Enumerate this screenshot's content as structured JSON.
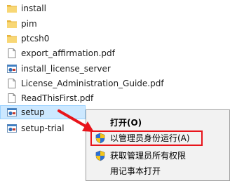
{
  "files": [
    {
      "name": "install",
      "icon": "folder-icon"
    },
    {
      "name": "pim",
      "icon": "folder-icon"
    },
    {
      "name": "ptcsh0",
      "icon": "folder-icon"
    },
    {
      "name": "export_affirmation.pdf",
      "icon": "document-icon"
    },
    {
      "name": "install_license_server",
      "icon": "application-icon"
    },
    {
      "name": "License_Administration_Guide.pdf",
      "icon": "document-icon"
    },
    {
      "name": "ReadThisFirst.pdf",
      "icon": "document-icon"
    },
    {
      "name": "setup",
      "icon": "application-icon",
      "selected": true
    },
    {
      "name": "setup-trial",
      "icon": "application-icon"
    }
  ],
  "context_menu": {
    "items": [
      {
        "label": "打开(O)",
        "icon": "",
        "bold": true
      },
      {
        "label": "以管理员身份运行(A)",
        "icon": "uac-shield-icon",
        "highlighted": true
      },
      {
        "label": "获取管理员所有权限",
        "icon": "uac-shield-icon"
      },
      {
        "label": "用记事本打开",
        "icon": ""
      }
    ]
  },
  "colors": {
    "selection_background": "#cce8ff",
    "selection_border": "#99d1ff",
    "menu_background": "#f2f2f2",
    "highlight_border": "#e8141b",
    "annotation_arrow": "#e8141b",
    "folder": "#f5c84c"
  }
}
